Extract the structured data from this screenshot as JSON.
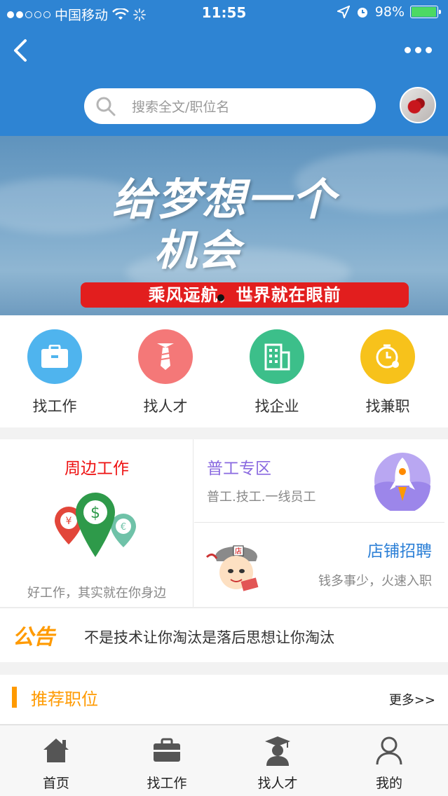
{
  "status_bar": {
    "carrier": "中国移动",
    "time": "11:55",
    "battery": "98%",
    "battery_level": 0.98
  },
  "header": {
    "search_placeholder": "搜索全文/职位名",
    "back_icon": "chevron-left-icon",
    "more_icon": "more-dots-icon"
  },
  "banner": {
    "headline_1": "给梦想一个",
    "headline_2": "机会",
    "slogan": "乘风远航，世界就在眼前",
    "slides": 3,
    "active_slide": 2
  },
  "quick_nav": [
    {
      "label": "找工作",
      "color": "#4fb4ee",
      "icon": "briefcase-icon"
    },
    {
      "label": "找人才",
      "color": "#f47878",
      "icon": "tie-icon"
    },
    {
      "label": "找企业",
      "color": "#3cbf8a",
      "icon": "building-icon"
    },
    {
      "label": "找兼职",
      "color": "#f7c21b",
      "icon": "clock-icon"
    }
  ],
  "features": {
    "nearby": {
      "title": "周边工作",
      "subtitle": "好工作，其实就在你身边"
    },
    "general": {
      "title": "普工专区",
      "subtitle": "普工.技工.一线员工"
    },
    "store": {
      "title": "店铺招聘",
      "subtitle": "钱多事少，火速入职"
    }
  },
  "notice": {
    "logo_text": "公告",
    "text": "不是技术让你淘汰是落后思想让你淘汰"
  },
  "recommended": {
    "title": "推荐职位",
    "more": "更多>>"
  },
  "tabbar": [
    {
      "label": "首页",
      "icon": "home-icon"
    },
    {
      "label": "找工作",
      "icon": "briefcase-icon"
    },
    {
      "label": "找人才",
      "icon": "graduate-icon"
    },
    {
      "label": "我的",
      "icon": "user-icon"
    }
  ],
  "colors": {
    "header": "#2e84d3",
    "accent_orange": "#ff9a00",
    "red": "#e21e1e"
  }
}
